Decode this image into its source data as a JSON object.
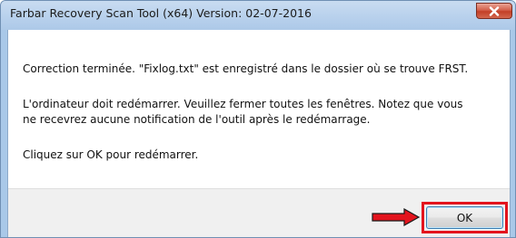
{
  "window": {
    "title": "Farbar Recovery Scan Tool (x64) Version: 02-07-2016"
  },
  "message": {
    "line1": "Correction terminée. \"Fixlog.txt\" est enregistré dans le dossier où se trouve FRST.",
    "line2": "L'ordinateur doit redémarrer. Veuillez fermer toutes les fenêtres. Notez que vous",
    "line3": "ne recevrez aucune notification de l'outil après le redémarrage.",
    "line4": "Cliquez sur OK pour redémarrer."
  },
  "buttons": {
    "ok_label": "OK"
  },
  "icons": {
    "close": "close-icon",
    "arrow": "red-arrow-icon"
  },
  "colors": {
    "title_bar": "#b7d0ec",
    "close_button": "#c84a33",
    "highlight": "#e3141d",
    "footer": "#f0f0f0"
  }
}
